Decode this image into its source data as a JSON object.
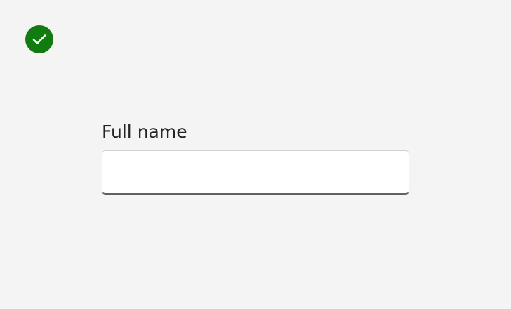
{
  "status": {
    "icon": "checkmark-circle-icon",
    "color": "#107c10"
  },
  "form": {
    "full_name": {
      "label": "Full name",
      "value": "",
      "placeholder": ""
    }
  }
}
